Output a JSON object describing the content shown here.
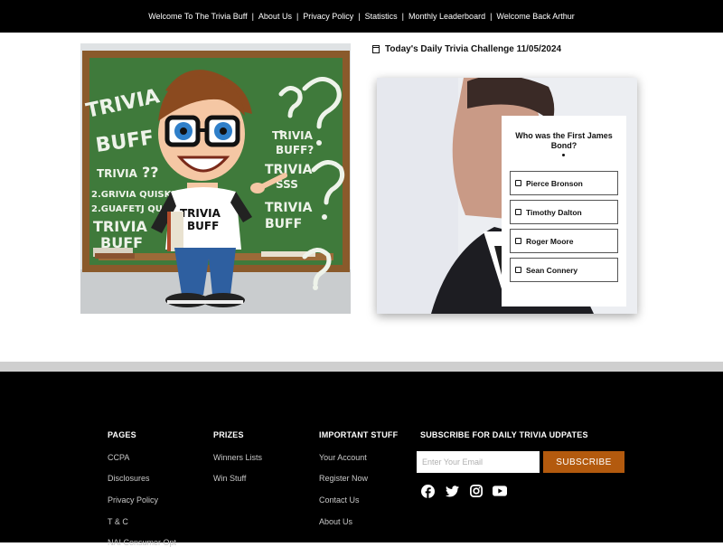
{
  "topnav": {
    "items": [
      "Welcome To The Trivia Buff",
      "About Us",
      "Privacy Policy",
      "Statistics",
      "Monthly Leaderboard",
      "Welcome Back Arthur"
    ],
    "separator": "|"
  },
  "hero": {
    "board_words": [
      "TRIVIA",
      "BUFF",
      "TRIVIA",
      "??",
      "2.GRIVIA QUISK?",
      "2.GUAFETJ QUI",
      "TRIVIA",
      "BUFF",
      "TRIVIA",
      "BUFF?",
      "TRIVIA",
      "SSS",
      "TRIVIA",
      "BUFF"
    ],
    "shirt_text": [
      "TRIVIA",
      "BUFF"
    ]
  },
  "challenge": {
    "title": "Today's Daily Trivia Challenge 11/05/2024"
  },
  "quiz": {
    "question": "Who was the First James Bond?",
    "options": [
      "Pierce Bronson",
      "Timothy Dalton",
      "Roger Moore",
      "Sean Connery"
    ]
  },
  "footer": {
    "pages": {
      "heading": "PAGES",
      "links": [
        "CCPA",
        "Disclosures",
        "Privacy Policy",
        "T & C",
        "NAI Consumer Opt"
      ]
    },
    "prizes": {
      "heading": "PRIZES",
      "links": [
        "Winners Lists",
        "Win Stuff"
      ]
    },
    "important": {
      "heading": "IMPORTANT STUFF",
      "links": [
        "Your Account",
        "Register Now",
        "Contact Us",
        "About Us"
      ]
    },
    "subscribe": {
      "heading": "SUBSCRIBE FOR DAILY TRIVIA UDPATES",
      "email_placeholder": "Enter Your Email",
      "button": "SUBSCRIBE"
    },
    "social": [
      "facebook-icon",
      "twitter-icon",
      "instagram-icon",
      "youtube-icon"
    ]
  },
  "colors": {
    "topbar": "#000000",
    "footer": "#000000",
    "subscribe_button": "#b35a0e",
    "chalkboard": "#3f7a3b"
  }
}
